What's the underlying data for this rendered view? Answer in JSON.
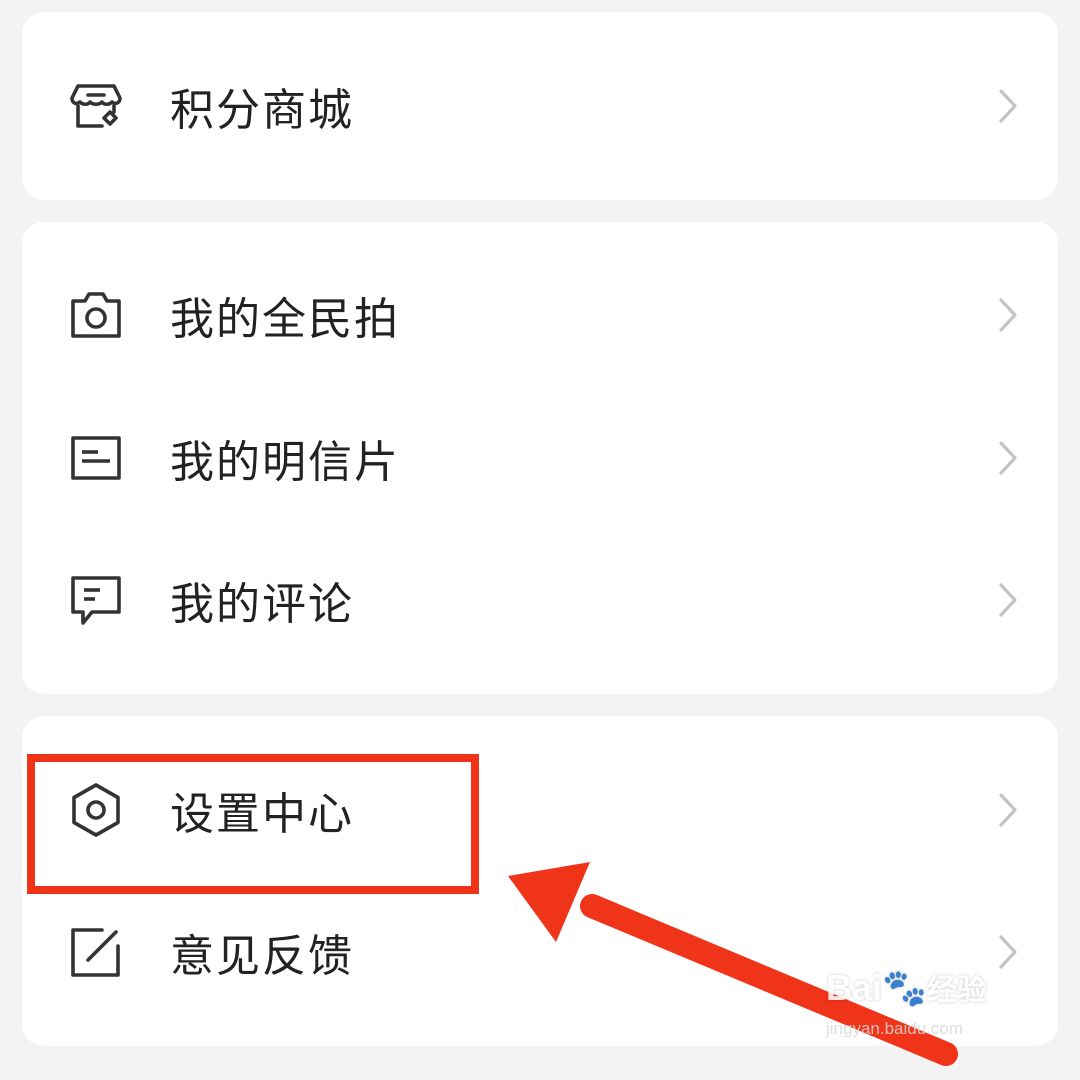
{
  "colors": {
    "background": "#f3f3f3",
    "card": "#ffffff",
    "text": "#222222",
    "chevron": "#c4c4c4",
    "annotation": "#f0341a"
  },
  "groups": [
    {
      "items": [
        {
          "label": "积分商城",
          "icon": "store-icon"
        }
      ]
    },
    {
      "items": [
        {
          "label": "我的全民拍",
          "icon": "camera-icon"
        },
        {
          "label": "我的明信片",
          "icon": "postcard-icon"
        },
        {
          "label": "我的评论",
          "icon": "comment-icon"
        }
      ]
    },
    {
      "items": [
        {
          "label": "设置中心",
          "icon": "settings-hexagon-icon"
        },
        {
          "label": "意见反馈",
          "icon": "feedback-edit-icon"
        }
      ]
    }
  ],
  "watermark": {
    "brand": "Bai",
    "brand_suffix": "经验",
    "site": "jingyan.baidu.com"
  }
}
